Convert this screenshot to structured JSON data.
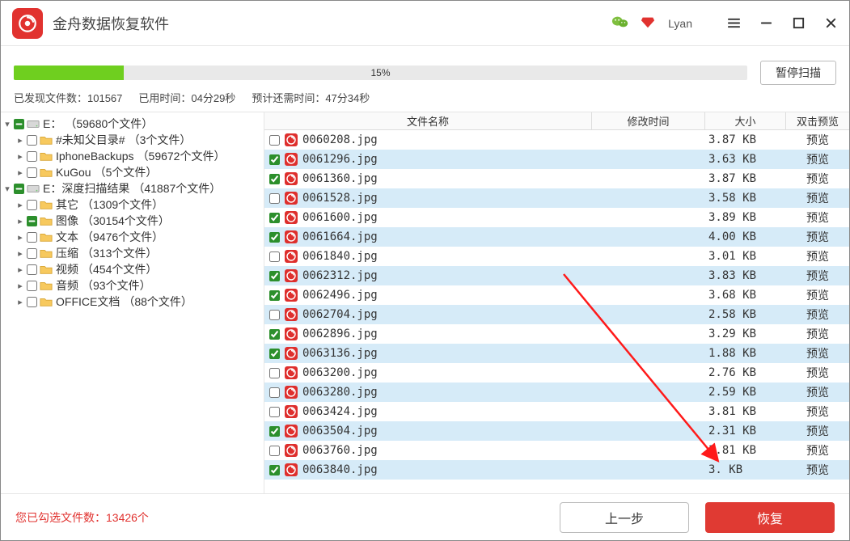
{
  "app": {
    "title": "金舟数据恢复软件",
    "username": "Lyan"
  },
  "progress": {
    "percent_text": "15%",
    "percent_value": 15,
    "pause_label": "暂停扫描",
    "found_label": "已发现文件数：101567",
    "elapsed_label": "已用时间：04分29秒",
    "remaining_label": "预计还需时间：47分34秒"
  },
  "tree": [
    {
      "level": 0,
      "toggle": "▾",
      "checked": "indeterminate",
      "icon": "disk",
      "label": "E：",
      "count": "（59680个文件）"
    },
    {
      "level": 1,
      "toggle": "▸",
      "checked": false,
      "icon": "folder",
      "label": "#未知父目录#",
      "count": "（3个文件）"
    },
    {
      "level": 1,
      "toggle": "▸",
      "checked": false,
      "icon": "folder",
      "label": "IphoneBackups",
      "count": "（59672个文件）"
    },
    {
      "level": 1,
      "toggle": "▸",
      "checked": false,
      "icon": "folder",
      "label": "KuGou",
      "count": "（5个文件）"
    },
    {
      "level": 0,
      "toggle": "▾",
      "checked": "indeterminate",
      "icon": "disk",
      "label": "E：深度扫描结果",
      "count": "（41887个文件）"
    },
    {
      "level": 1,
      "toggle": "▸",
      "checked": false,
      "icon": "folder",
      "label": "其它",
      "count": "（1309个文件）"
    },
    {
      "level": 1,
      "toggle": "▸",
      "checked": "indeterminate",
      "icon": "folder",
      "label": "图像",
      "count": "（30154个文件）"
    },
    {
      "level": 1,
      "toggle": "▸",
      "checked": false,
      "icon": "folder",
      "label": "文本",
      "count": "（9476个文件）"
    },
    {
      "level": 1,
      "toggle": "▸",
      "checked": false,
      "icon": "folder",
      "label": "压缩",
      "count": "（313个文件）"
    },
    {
      "level": 1,
      "toggle": "▸",
      "checked": false,
      "icon": "folder",
      "label": "视频",
      "count": "（454个文件）"
    },
    {
      "level": 1,
      "toggle": "▸",
      "checked": false,
      "icon": "folder",
      "label": "音频",
      "count": "（93个文件）"
    },
    {
      "level": 1,
      "toggle": "▸",
      "checked": false,
      "icon": "folder",
      "label": "OFFICE文档",
      "count": "（88个文件）"
    }
  ],
  "columns": {
    "name": "文件名称",
    "time": "修改时间",
    "size": "大小",
    "preview": "双击预览"
  },
  "preview_label": "预览",
  "files": [
    {
      "checked": false,
      "name": "0060208.jpg",
      "size": "3.87 KB"
    },
    {
      "checked": true,
      "name": "0061296.jpg",
      "size": "3.63 KB"
    },
    {
      "checked": true,
      "name": "0061360.jpg",
      "size": "3.87 KB"
    },
    {
      "checked": false,
      "name": "0061528.jpg",
      "size": "3.58 KB"
    },
    {
      "checked": true,
      "name": "0061600.jpg",
      "size": "3.89 KB"
    },
    {
      "checked": true,
      "name": "0061664.jpg",
      "size": "4.00 KB"
    },
    {
      "checked": false,
      "name": "0061840.jpg",
      "size": "3.01 KB"
    },
    {
      "checked": true,
      "name": "0062312.jpg",
      "size": "3.83 KB"
    },
    {
      "checked": true,
      "name": "0062496.jpg",
      "size": "3.68 KB"
    },
    {
      "checked": false,
      "name": "0062704.jpg",
      "size": "2.58 KB"
    },
    {
      "checked": true,
      "name": "0062896.jpg",
      "size": "3.29 KB"
    },
    {
      "checked": true,
      "name": "0063136.jpg",
      "size": "1.88 KB"
    },
    {
      "checked": false,
      "name": "0063200.jpg",
      "size": "2.76 KB"
    },
    {
      "checked": false,
      "name": "0063280.jpg",
      "size": "2.59 KB"
    },
    {
      "checked": false,
      "name": "0063424.jpg",
      "size": "3.81 KB"
    },
    {
      "checked": true,
      "name": "0063504.jpg",
      "size": "2.31 KB"
    },
    {
      "checked": false,
      "name": "0063760.jpg",
      "size": "3.81 KB"
    },
    {
      "checked": true,
      "name": "0063840.jpg",
      "size": "3.   KB"
    }
  ],
  "footer": {
    "selected_text": "您已勾选文件数：13426个",
    "prev_label": "上一步",
    "recover_label": "恢复"
  }
}
